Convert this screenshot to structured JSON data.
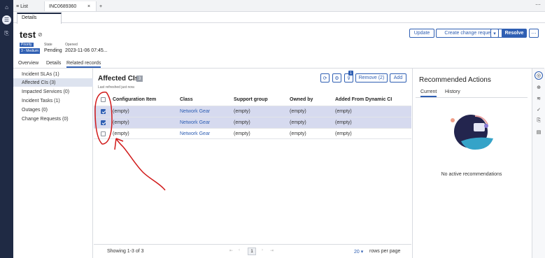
{
  "top_tabs": {
    "list": "List",
    "record": "INC0689360",
    "close": "×",
    "add": "+",
    "more": "⋯"
  },
  "sub_tab": "Details",
  "record": {
    "title": "test",
    "priority_label": "Priority",
    "priority_value": "3 - Medium",
    "state_label": "State",
    "state_value": "Pending",
    "opened_label": "Opened",
    "opened_value": "2023-11-06 07:45..."
  },
  "header_buttons": {
    "update": "Update",
    "create_change": "Create change request",
    "resolve": "Resolve",
    "dropdown": "▾",
    "more": "⋯"
  },
  "record_tabs": [
    "Overview",
    "Details",
    "Related records"
  ],
  "left_nav": [
    "Incident SLAs (1)",
    "Affected CIs (3)",
    "Impacted Services (0)",
    "Incident Tasks (1)",
    "Outages (0)",
    "Change Requests (0)"
  ],
  "affected_cis": {
    "title": "Affected CIs",
    "count": "3",
    "refreshed": "Last refreshed just now.",
    "filter_badge": "1",
    "remove_label": "Remove (2)",
    "add_label": "Add",
    "columns": [
      "Configuration Item",
      "Class",
      "Support group",
      "Owned by",
      "Added From Dynamic CI"
    ],
    "rows": [
      {
        "ci": "(empty)",
        "class": "Network Gear",
        "support": "(empty)",
        "owner": "(empty)",
        "dynamic": "(empty)",
        "selected": true
      },
      {
        "ci": "(empty)",
        "class": "Network Gear",
        "support": "(empty)",
        "owner": "(empty)",
        "dynamic": "(empty)",
        "selected": true
      },
      {
        "ci": "(empty)",
        "class": "Network Gear",
        "support": "(empty)",
        "owner": "(empty)",
        "dynamic": "(empty)",
        "selected": false
      }
    ],
    "showing": "Showing 1-3 of 3",
    "page": "1",
    "per_page": "20",
    "per_page_label": "rows per page"
  },
  "recommended": {
    "title": "Recommended Actions",
    "tabs": [
      "Current",
      "History"
    ],
    "empty": "No active recommendations"
  },
  "colors": {
    "accent": "#2f5fb3",
    "nav": "#1f2a44",
    "selected_row": "#d6daef",
    "annotation": "#d11a1a"
  }
}
